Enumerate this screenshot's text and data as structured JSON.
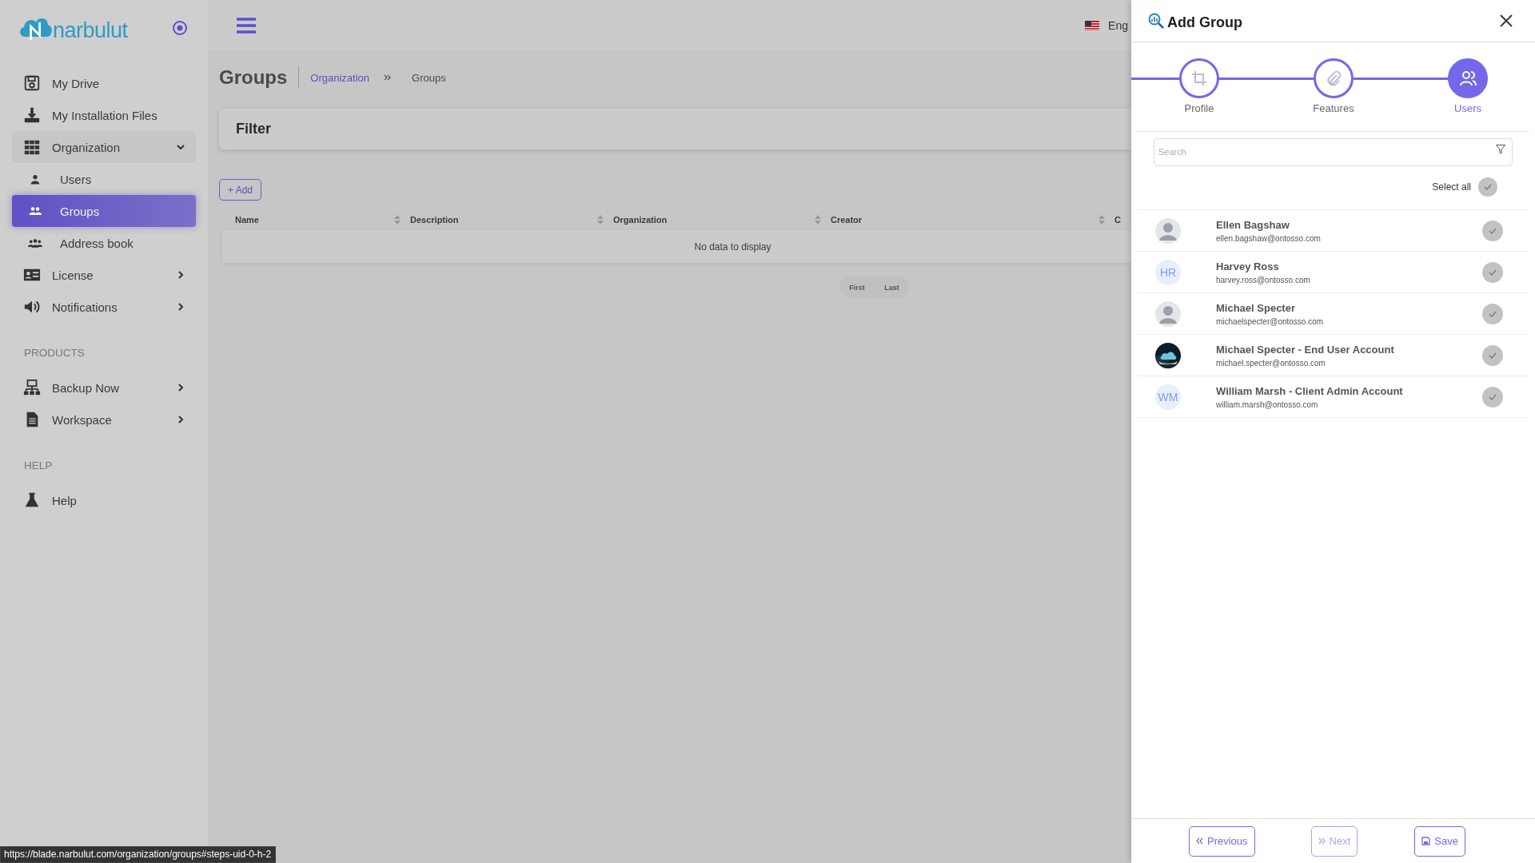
{
  "sidebar": {
    "brand": "narbulut",
    "sections": [
      {
        "items": [
          {
            "label": "My Drive",
            "selected": false
          },
          {
            "label": "My Installation Files",
            "selected": false
          },
          {
            "label": "Organization",
            "selected": false,
            "expanded": true,
            "children": [
              {
                "label": "Users",
                "selected": false
              },
              {
                "label": "Groups",
                "selected": true
              },
              {
                "label": "Address book",
                "selected": false
              }
            ]
          },
          {
            "label": "License",
            "selected": false,
            "expanded": false
          },
          {
            "label": "Notifications",
            "selected": false,
            "expanded": false
          }
        ]
      },
      {
        "heading": "PRODUCTS",
        "items": [
          {
            "label": "Backup Now",
            "selected": false,
            "expanded": false
          },
          {
            "label": "Workspace",
            "selected": false,
            "expanded": false
          }
        ]
      },
      {
        "heading": "HELP",
        "items": [
          {
            "label": "Help",
            "selected": false
          }
        ]
      }
    ]
  },
  "topbar": {
    "language": "Eng"
  },
  "page": {
    "title": "Groups",
    "breadcrumb": [
      "Organization",
      "Groups"
    ],
    "filter_title": "Filter",
    "add_button": "+ Add",
    "table": {
      "columns": [
        "Name",
        "Description",
        "Organization",
        "Creator",
        "C"
      ],
      "empty_message": "No data to display"
    },
    "pager": [
      "First",
      "Last"
    ]
  },
  "panel": {
    "title": "Add Group",
    "steps": [
      {
        "label": "Profile",
        "selected": false
      },
      {
        "label": "Features",
        "selected": false
      },
      {
        "label": "Users",
        "selected": true
      }
    ],
    "search": {
      "placeholder": "Search"
    },
    "select_all": {
      "label": "Select all",
      "checked": false
    },
    "users": [
      {
        "name": "Ellen Bagshaw",
        "email": "ellen.bagshaw@ontosso.com",
        "avatar": {
          "kind": "silhouette"
        },
        "checked": false
      },
      {
        "name": "Harvey Ross",
        "email": "harvey.ross@ontosso.com",
        "avatar": {
          "kind": "initials",
          "initials": "HR"
        },
        "checked": false
      },
      {
        "name": "Michael Specter",
        "email": "michaelspecter@ontosso.com",
        "avatar": {
          "kind": "silhouette"
        },
        "checked": false
      },
      {
        "name": "Michael Specter - End User Account",
        "email": "michael.specter@ontosso.com",
        "checked": false
      },
      {
        "name": "William Marsh - Client Admin Account",
        "email": "william.marsh@ontosso.com",
        "avatar": {
          "kind": "initials",
          "initials": "WM"
        },
        "checked": false
      }
    ],
    "buttons": [
      {
        "label": "Previous",
        "disabled": false
      },
      {
        "label": "Next",
        "disabled": true
      },
      {
        "label": "Save",
        "disabled": false
      }
    ]
  },
  "status_url": "https://blade.narbulut.com/organization/groups#steps-uid-0-h-2"
}
